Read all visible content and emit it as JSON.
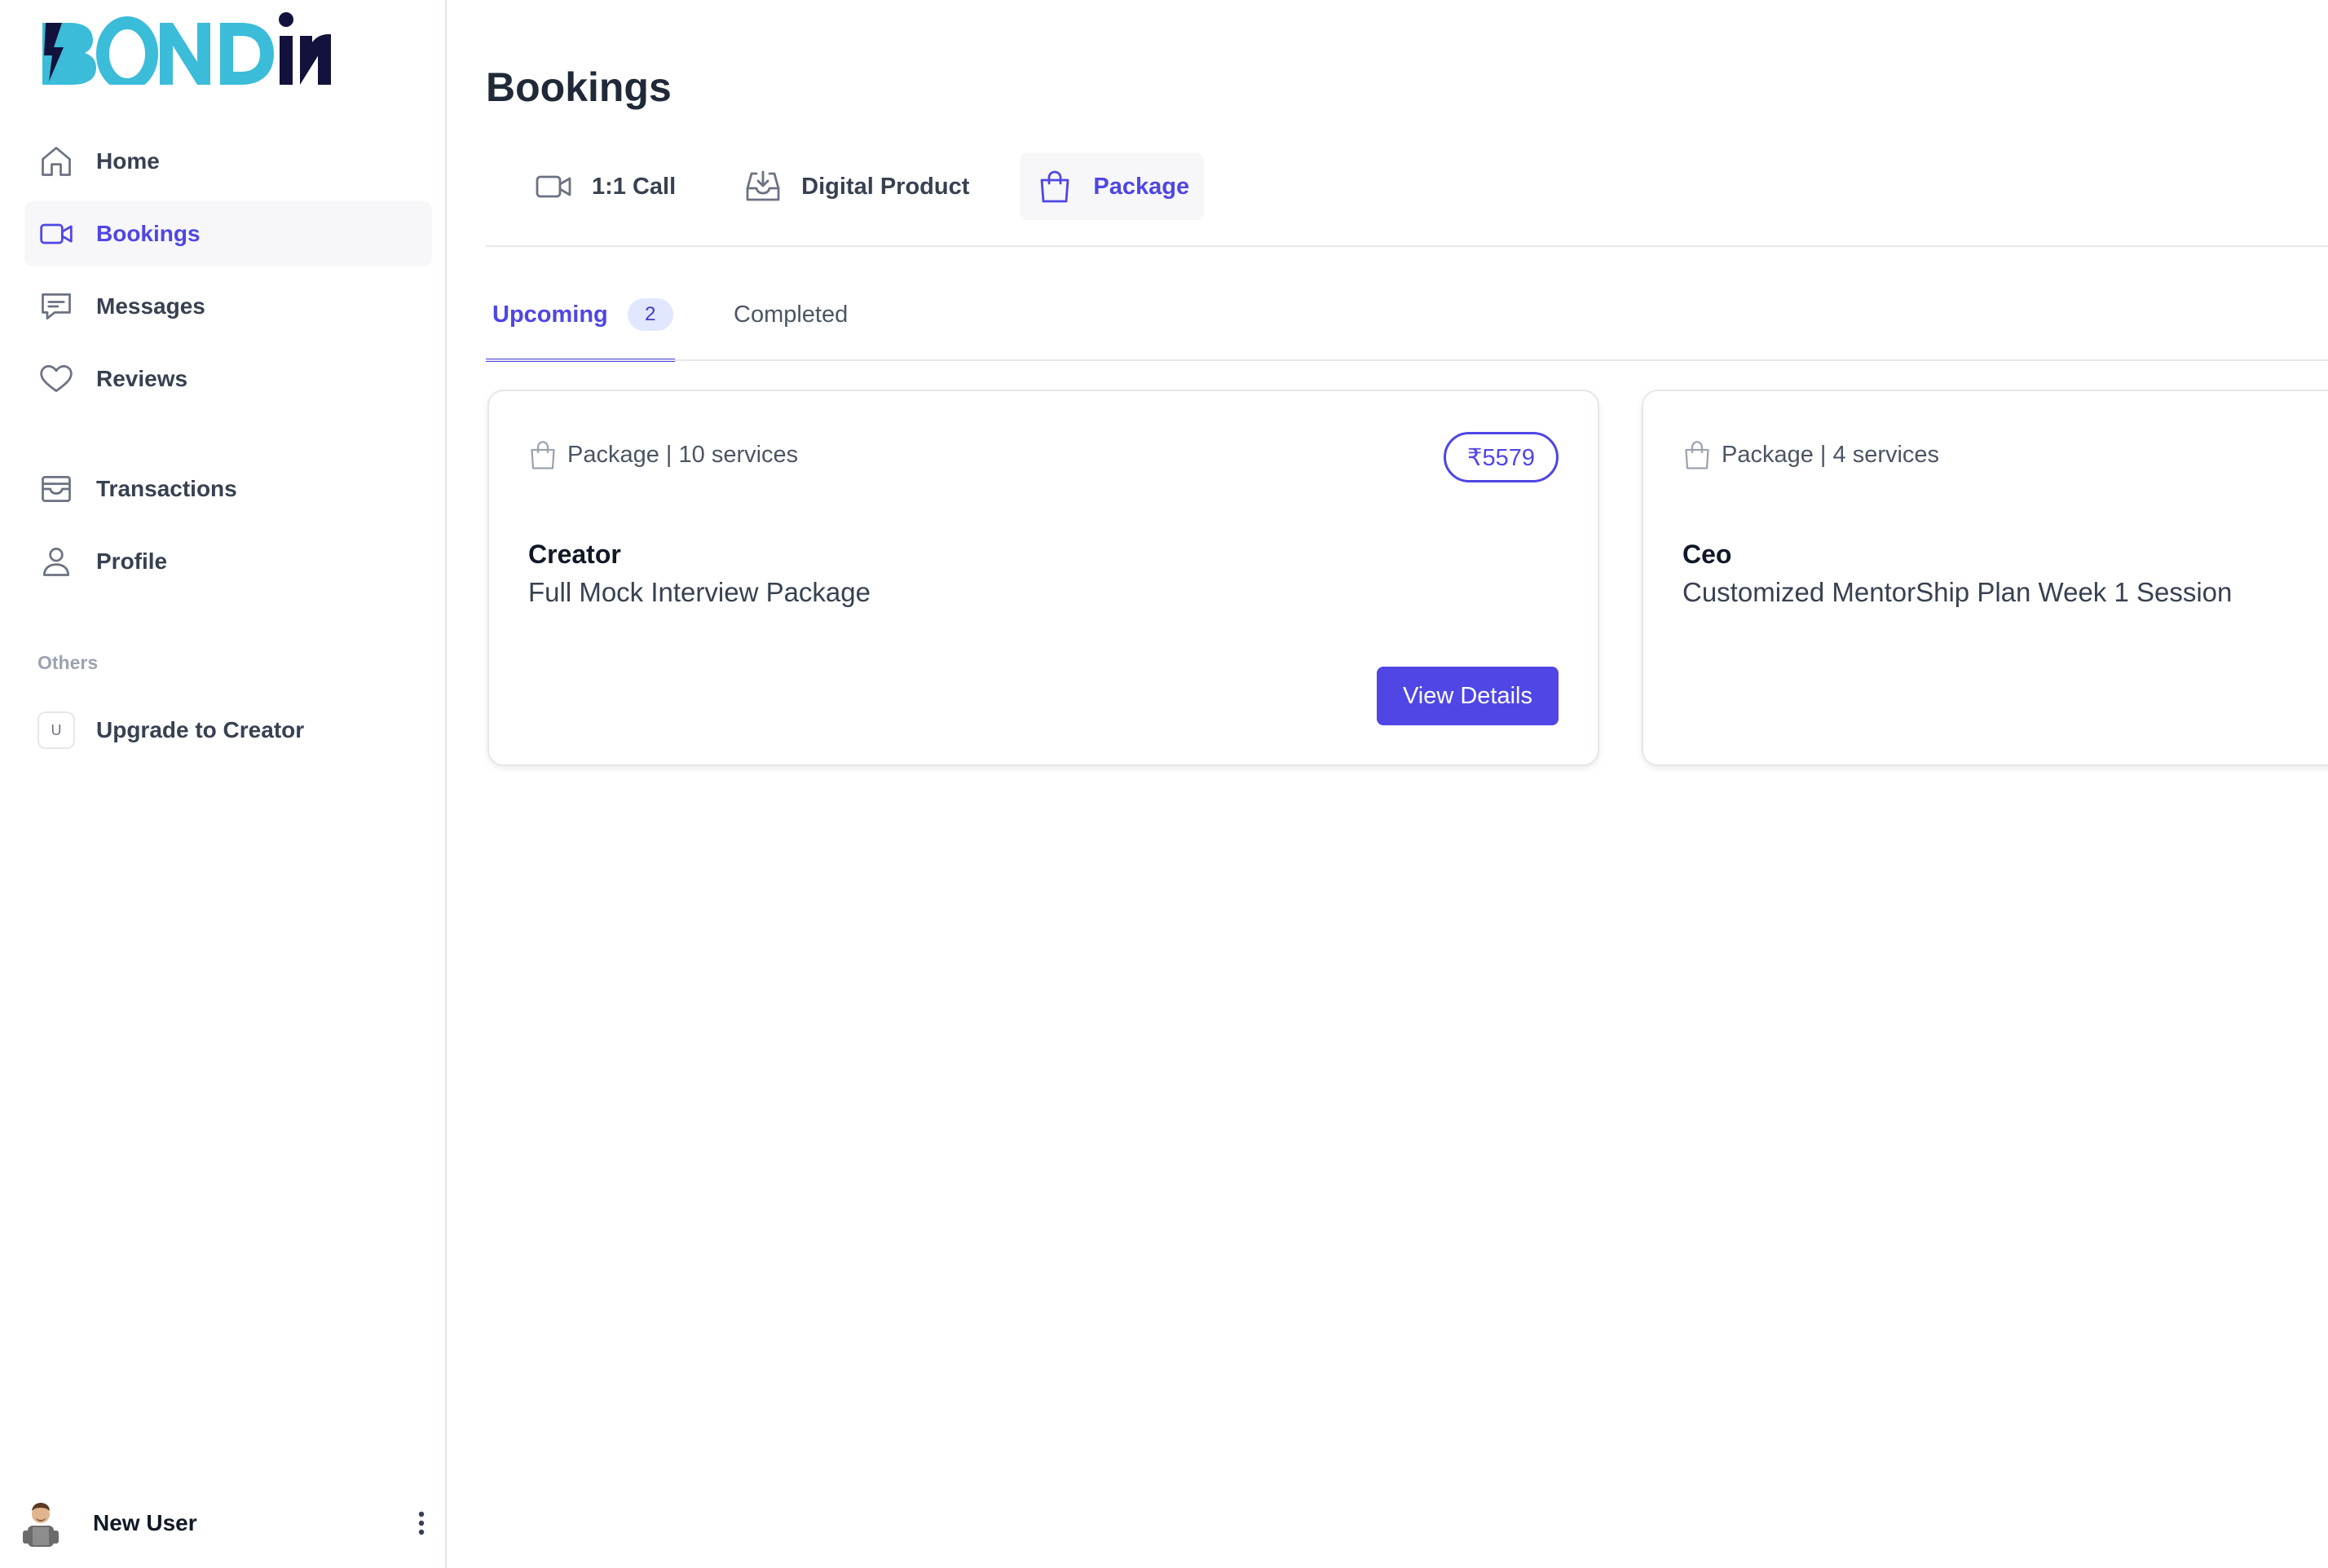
{
  "app": {
    "logo_text": "BONDin"
  },
  "sidebar": {
    "items": [
      {
        "label": "Home",
        "icon": "home-icon"
      },
      {
        "label": "Bookings",
        "icon": "video-icon"
      },
      {
        "label": "Messages",
        "icon": "message-icon"
      },
      {
        "label": "Reviews",
        "icon": "heart-icon"
      },
      {
        "label": "Transactions",
        "icon": "wallet-icon"
      },
      {
        "label": "Profile",
        "icon": "user-icon"
      }
    ],
    "active": "Bookings",
    "section_label": "Others",
    "upgrade": {
      "label": "Upgrade to Creator",
      "badge": "U"
    },
    "user": {
      "name": "New User"
    }
  },
  "main": {
    "title": "Bookings",
    "type_tabs": [
      {
        "label": "1:1 Call",
        "icon": "video-icon"
      },
      {
        "label": "Digital Product",
        "icon": "inbox-download-icon"
      },
      {
        "label": "Package",
        "icon": "shopping-bag-icon"
      }
    ],
    "active_type_tab": "Package",
    "status_tabs": [
      {
        "label": "Upcoming",
        "count": "2"
      },
      {
        "label": "Completed"
      }
    ],
    "active_status_tab": "Upcoming",
    "cards": [
      {
        "meta": "Package | 10 services",
        "price": "₹5579",
        "name": "Creator",
        "title": "Full Mock Interview Package",
        "button": "View Details"
      },
      {
        "meta": "Package | 4 services",
        "name": "Ceo",
        "title": "Customized MentorShip Plan Week 1 Session"
      }
    ]
  },
  "colors": {
    "accent": "#4f46e5",
    "logo_teal": "#3bbcd9",
    "logo_navy": "#12123d",
    "badge_bg": "#e0e7ff",
    "border": "#e5e7eb"
  }
}
